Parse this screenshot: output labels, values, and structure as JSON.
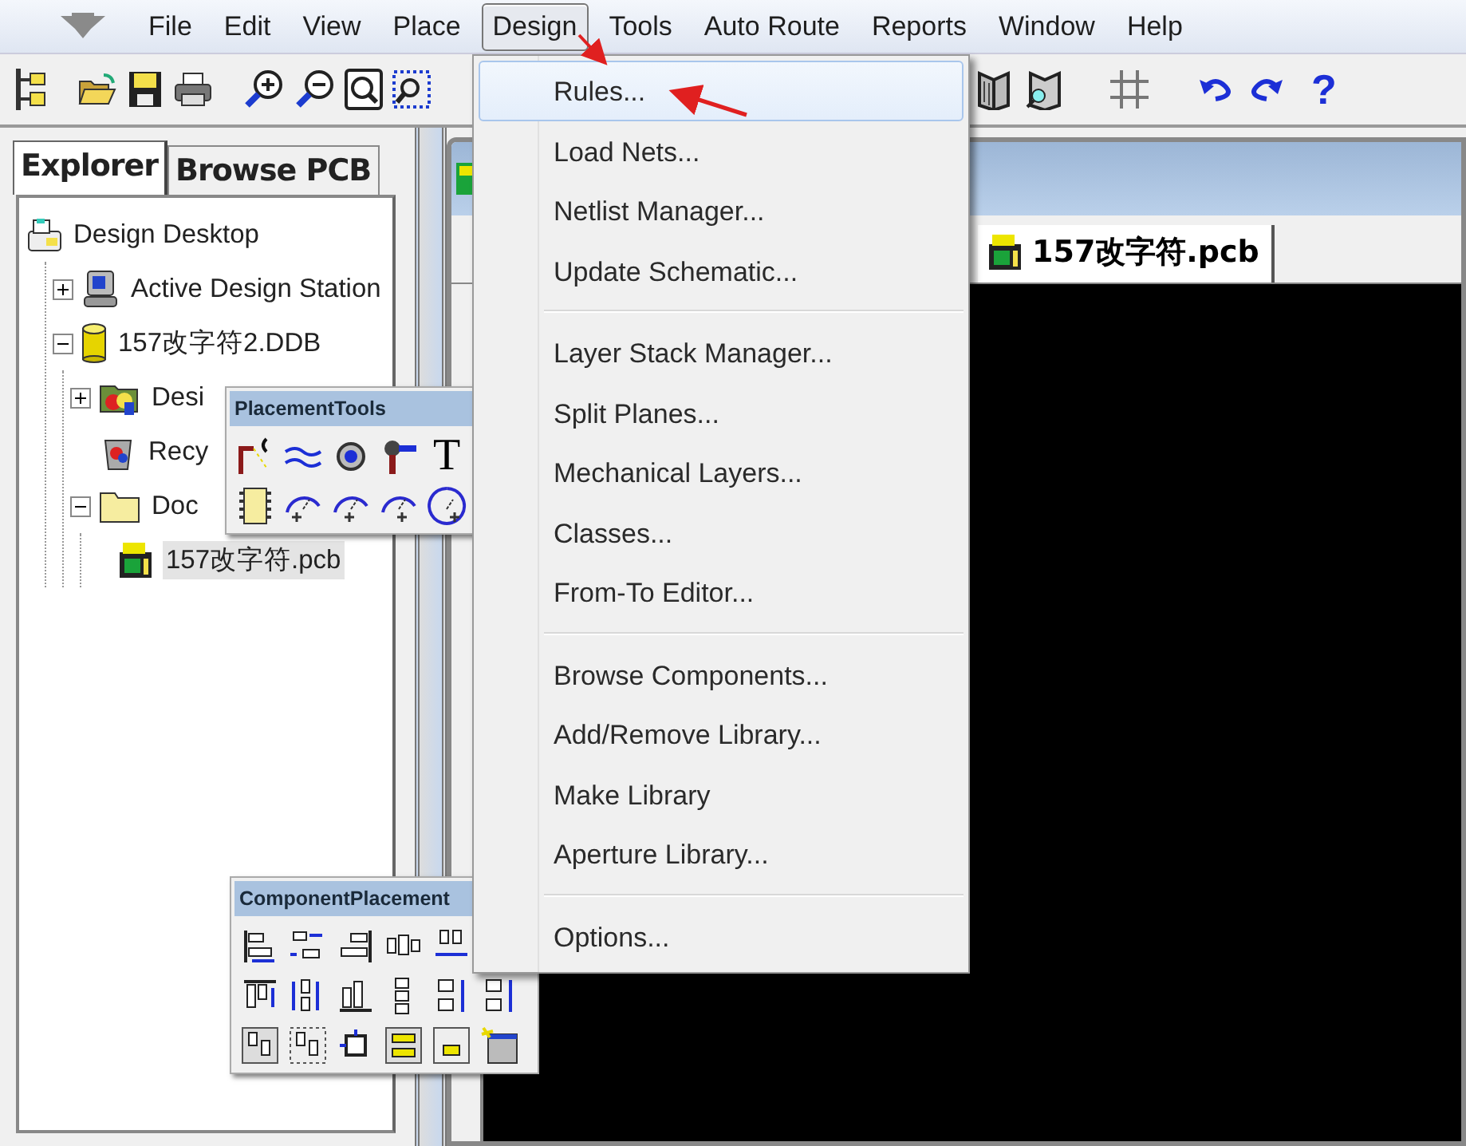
{
  "menubar": {
    "items": [
      {
        "label": "File",
        "selected": false
      },
      {
        "label": "Edit",
        "selected": false
      },
      {
        "label": "View",
        "selected": false
      },
      {
        "label": "Place",
        "selected": false
      },
      {
        "label": "Design",
        "selected": true
      },
      {
        "label": "Tools",
        "selected": false
      },
      {
        "label": "Auto Route",
        "selected": false
      },
      {
        "label": "Reports",
        "selected": false
      },
      {
        "label": "Window",
        "selected": false
      },
      {
        "label": "Help",
        "selected": false
      }
    ]
  },
  "toolbar": {
    "help_glyph": "?"
  },
  "explorer": {
    "tabs": [
      {
        "label": "Explorer",
        "selected": true
      },
      {
        "label": "Browse PCB",
        "selected": false
      }
    ],
    "tree": [
      {
        "label": "Design Desktop",
        "kind": "desktop",
        "selected": false,
        "children": [
          {
            "label": "Active Design Station",
            "kind": "station",
            "expanded": false,
            "selected": false
          },
          {
            "label": "157改字符2.DDB",
            "kind": "database",
            "expanded": true,
            "selected": false,
            "children": [
              {
                "label": "Desi",
                "kind": "folder-set",
                "expanded": false,
                "selected": false
              },
              {
                "label": "Recy",
                "kind": "recycle",
                "selected": false
              },
              {
                "label": "Doc",
                "kind": "folder",
                "expanded": true,
                "selected": false,
                "children": [
                  {
                    "label": "157改字符.pcb",
                    "kind": "pcb",
                    "selected": true
                  }
                ]
              }
            ]
          }
        ]
      }
    ]
  },
  "document": {
    "tabs": [
      {
        "label": "157改字符.pcb",
        "selected": true
      }
    ]
  },
  "design_menu": {
    "groups": [
      {
        "items": [
          {
            "label": "Rules...",
            "selected": true
          },
          {
            "label": "Load Nets...",
            "selected": false
          },
          {
            "label": "Netlist Manager...",
            "selected": false
          },
          {
            "label": "Update Schematic...",
            "selected": false
          }
        ]
      },
      {
        "items": [
          {
            "label": "Layer Stack Manager...",
            "selected": false
          },
          {
            "label": "Split Planes...",
            "selected": false
          },
          {
            "label": "Mechanical Layers...",
            "selected": false
          },
          {
            "label": "Classes...",
            "selected": false
          },
          {
            "label": "From-To Editor...",
            "selected": false
          }
        ]
      },
      {
        "items": [
          {
            "label": "Browse Components...",
            "selected": false
          },
          {
            "label": "Add/Remove Library...",
            "selected": false
          },
          {
            "label": "Make Library",
            "selected": false
          },
          {
            "label": "Aperture Library...",
            "selected": false
          }
        ]
      },
      {
        "items": [
          {
            "label": "Options...",
            "selected": false
          }
        ]
      }
    ]
  },
  "placement_tools": {
    "title": "PlacementTools",
    "text_tool_glyph": "T"
  },
  "component_placement": {
    "title": "ComponentPlacement"
  }
}
